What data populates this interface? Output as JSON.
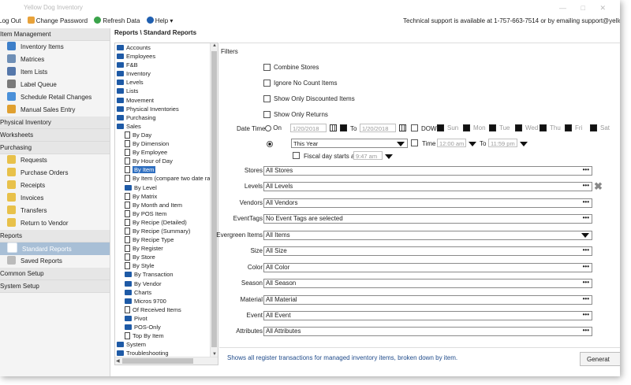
{
  "window": {
    "title": "Yellow Dog Inventory",
    "controls": "— □ ✕"
  },
  "menubar": {
    "logout": "Log Out",
    "change_password": "Change Password",
    "refresh": "Refresh Data",
    "help": "Help",
    "support": "Technical support is available at 1-757-663-7514 or by emailing support@yellowdogsoftware.com"
  },
  "sidebar": {
    "sections": [
      {
        "label": "Item Management",
        "items": [
          {
            "label": "Inventory Items",
            "icon": "items-icon",
            "color": "#3d7fc9"
          },
          {
            "label": "Matrices",
            "icon": "matrix-icon",
            "color": "#6f8fb6"
          },
          {
            "label": "Item Lists",
            "icon": "list-icon",
            "color": "#5577aa"
          },
          {
            "label": "Label Queue",
            "icon": "label-icon",
            "color": "#7a7a7a"
          },
          {
            "label": "Schedule Retail Changes",
            "icon": "schedule-icon",
            "color": "#4a90d9"
          },
          {
            "label": "Manual Sales Entry",
            "icon": "entry-icon",
            "color": "#e0a030"
          }
        ]
      },
      {
        "label": "Physical Inventory",
        "items": []
      },
      {
        "label": "Worksheets",
        "items": []
      },
      {
        "label": "Purchasing",
        "items": [
          {
            "label": "Requests",
            "icon": "requests-icon",
            "color": "#e8c14a"
          },
          {
            "label": "Purchase Orders",
            "icon": "purchase-orders-icon",
            "color": "#e8c14a"
          },
          {
            "label": "Receipts",
            "icon": "receipts-icon",
            "color": "#e8c14a"
          },
          {
            "label": "Invoices",
            "icon": "invoices-icon",
            "color": "#e8c14a"
          },
          {
            "label": "Transfers",
            "icon": "transfers-icon",
            "color": "#e8c14a"
          },
          {
            "label": "Return to Vendor",
            "icon": "return-icon",
            "color": "#e8c14a"
          }
        ]
      },
      {
        "label": "Reports",
        "items": [
          {
            "label": "Standard Reports",
            "icon": "report-icon",
            "color": "#ffffff",
            "selected": true
          },
          {
            "label": "Saved Reports",
            "icon": "saved-report-icon",
            "color": "#bbbbbb"
          }
        ]
      },
      {
        "label": "Common Setup",
        "items": []
      },
      {
        "label": "System Setup",
        "items": []
      }
    ]
  },
  "breadcrumb": "Reports \\ Standard Reports",
  "tree": [
    {
      "label": "Accounts",
      "type": "folder",
      "level": 1
    },
    {
      "label": "Employees",
      "type": "folder",
      "level": 1
    },
    {
      "label": "F&B",
      "type": "folder",
      "level": 1
    },
    {
      "label": "Inventory",
      "type": "folder",
      "level": 1
    },
    {
      "label": "Levels",
      "type": "folder",
      "level": 1
    },
    {
      "label": "Lists",
      "type": "folder",
      "level": 1
    },
    {
      "label": "Movement",
      "type": "folder",
      "level": 1
    },
    {
      "label": "Physical Inventories",
      "type": "folder",
      "level": 1
    },
    {
      "label": "Purchasing",
      "type": "folder",
      "level": 1
    },
    {
      "label": "Sales",
      "type": "open-folder",
      "level": 1
    },
    {
      "label": "By Day",
      "type": "doc",
      "level": 2
    },
    {
      "label": "By Dimension",
      "type": "doc",
      "level": 2
    },
    {
      "label": "By Employee",
      "type": "doc",
      "level": 2
    },
    {
      "label": "By Hour of Day",
      "type": "doc",
      "level": 2
    },
    {
      "label": "By Item",
      "type": "doc",
      "level": 2,
      "selected": true
    },
    {
      "label": "By Item (compare two date ra",
      "type": "doc",
      "level": 2
    },
    {
      "label": "By Level",
      "type": "folder",
      "level": 2
    },
    {
      "label": "By Matrix",
      "type": "doc",
      "level": 2
    },
    {
      "label": "By Month and Item",
      "type": "doc",
      "level": 2
    },
    {
      "label": "By POS Item",
      "type": "doc",
      "level": 2
    },
    {
      "label": "By Recipe (Detailed)",
      "type": "doc",
      "level": 2
    },
    {
      "label": "By Recipe (Summary)",
      "type": "doc",
      "level": 2
    },
    {
      "label": "By Recipe Type",
      "type": "doc",
      "level": 2
    },
    {
      "label": "By Register",
      "type": "doc",
      "level": 2
    },
    {
      "label": "By Store",
      "type": "doc",
      "level": 2
    },
    {
      "label": "By Style",
      "type": "doc",
      "level": 2
    },
    {
      "label": "By Transaction",
      "type": "folder",
      "level": 2
    },
    {
      "label": "By Vendor",
      "type": "folder",
      "level": 2
    },
    {
      "label": "Charts",
      "type": "folder",
      "level": 2
    },
    {
      "label": "Micros 9700",
      "type": "folder",
      "level": 2
    },
    {
      "label": "Of Received Items",
      "type": "doc",
      "level": 2
    },
    {
      "label": "Pivot",
      "type": "folder",
      "level": 2
    },
    {
      "label": "POS-Only",
      "type": "folder",
      "level": 2
    },
    {
      "label": "Top By Item",
      "type": "doc",
      "level": 2
    },
    {
      "label": "System",
      "type": "folder",
      "level": 1
    },
    {
      "label": "Troubleshooting",
      "type": "folder",
      "level": 1
    }
  ],
  "filters": {
    "heading": "Filters",
    "checkboxes": [
      "Combine Stores",
      "Ignore No Count Items",
      "Show Only Discounted Items",
      "Show Only Returns"
    ],
    "datetime": {
      "label": "Date Time",
      "on_label": "On",
      "date_from": "1/20/2018",
      "to_label": "To",
      "date_to": "1/20/2018",
      "dow_label": "DOW",
      "days": [
        "Sun",
        "Mon",
        "Tue",
        "Wed",
        "Thu",
        "Fri",
        "Sat"
      ],
      "period": "This Year",
      "time_label": "Time",
      "time_from": "12:00 am",
      "time_to_label": "To",
      "time_to": "11:59 pm",
      "fiscal_label": "Fiscal day starts at",
      "fiscal_time": "9:47 am"
    },
    "fields": [
      {
        "label": "Stores",
        "value": "All Stores",
        "control": "dots"
      },
      {
        "label": "Levels",
        "value": "All Levels",
        "control": "dots",
        "clear": true
      },
      {
        "label": "Vendors",
        "value": "All Vendors",
        "control": "dots"
      },
      {
        "label": "EventTags",
        "value": "No Event Tags are selected",
        "control": "dots"
      },
      {
        "label": "Evergreen Items",
        "value": "All Items",
        "control": "dropdown"
      },
      {
        "label": "Size",
        "value": "All Size",
        "control": "dots"
      },
      {
        "label": "Color",
        "value": "All Color",
        "control": "dots"
      },
      {
        "label": "Season",
        "value": "All Season",
        "control": "dots"
      },
      {
        "label": "Material",
        "value": "All Material",
        "control": "dots"
      },
      {
        "label": "Event",
        "value": "All Event",
        "control": "dots"
      },
      {
        "label": "Attributes",
        "value": "All Attributes",
        "control": "dots"
      }
    ]
  },
  "status": {
    "description": "Shows all register transactions for managed inventory items, broken down by item.",
    "generate_label": "Generat"
  }
}
